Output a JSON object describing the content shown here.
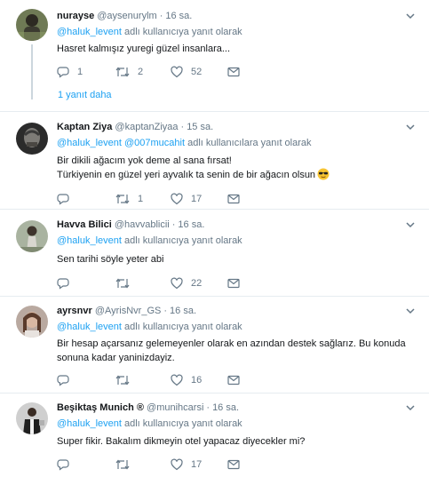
{
  "tweets": [
    {
      "name": "nurayse",
      "handle": "@aysenurylm",
      "time": "16 sa.",
      "reply_mentions": [
        "@haluk_levent"
      ],
      "reply_suffix": "adlı kullanıcıya yanıt olarak",
      "lines": [
        "Hasret kalmışız yuregi güzel insanlara..."
      ],
      "replies": "1",
      "retweets": "2",
      "likes": "52",
      "more_replies": "1 yanıt daha"
    },
    {
      "name": "Kaptan Ziya",
      "handle": "@kaptanZiyaa",
      "time": "15 sa.",
      "reply_mentions": [
        "@haluk_levent",
        "@007mucahit"
      ],
      "reply_suffix": "adlı kullanıcılara yanıt olarak",
      "lines": [
        "Bir dikili ağacım yok deme al sana fırsat!",
        "Türkiyenin en güzel yeri ayvalık ta senin de bir ağacın olsun"
      ],
      "replies": "",
      "retweets": "1",
      "likes": "17"
    },
    {
      "name": "Havva Bilici",
      "handle": "@havvablicii",
      "time": "16 sa.",
      "reply_mentions": [
        "@haluk_levent"
      ],
      "reply_suffix": "adlı kullanıcıya yanıt olarak",
      "lines": [
        "Sen tarihi söyle yeter abi"
      ],
      "replies": "",
      "retweets": "",
      "likes": "22"
    },
    {
      "name": "ayrsnvr",
      "handle": "@AyrisNvr_GS",
      "time": "16 sa.",
      "reply_mentions": [
        "@haluk_levent"
      ],
      "reply_suffix": "adlı kullanıcıya yanıt olarak",
      "lines": [
        "Bir hesap açarsanız gelemeyenler olarak en azından destek sağlarız. Bu konuda",
        "sonuna kadar yaninizdayiz."
      ],
      "replies": "",
      "retweets": "",
      "likes": "16"
    },
    {
      "name": "Beşiktaş Munich ®",
      "handle": "@munihcarsi",
      "time": "16 sa.",
      "reply_mentions": [
        "@haluk_levent"
      ],
      "reply_suffix": "adlı kullanıcıya yanıt olarak",
      "lines": [
        "Super fikir. Bakalım dikmeyin otel yapacaz diyecekler mi?"
      ],
      "replies": "",
      "retweets": "",
      "likes": "17"
    }
  ],
  "icons": {
    "reply": "reply-icon",
    "retweet": "retweet-icon",
    "like": "heart-icon",
    "dm": "envelope-icon",
    "menu": "chevron-down-icon",
    "emoji": "sunglasses-emoji-icon"
  },
  "colors": {
    "link": "#1da1f2",
    "muted": "#657786",
    "divider": "#e6ecf0",
    "thread_line": "#ccd6dd"
  }
}
